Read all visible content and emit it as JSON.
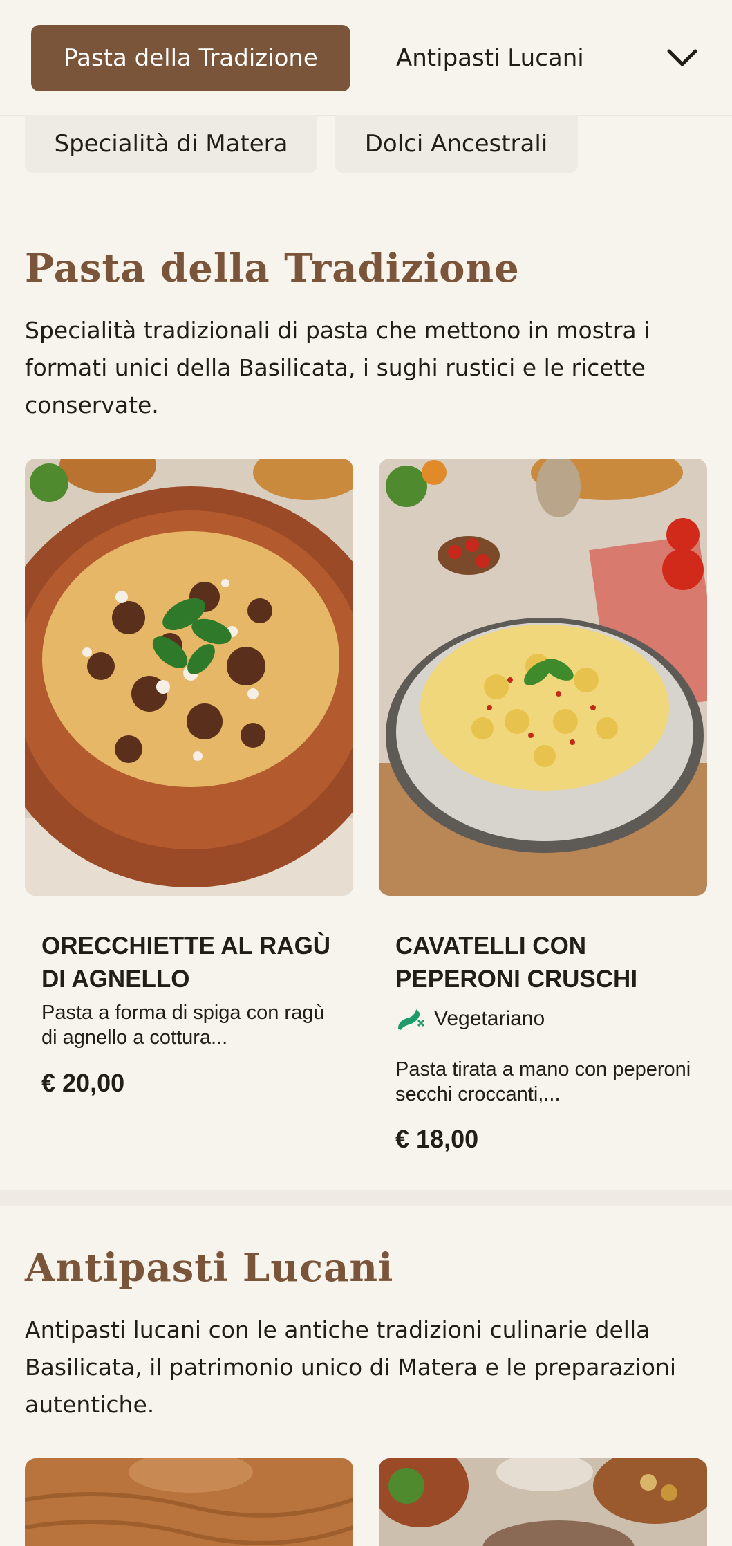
{
  "nav": {
    "tabs": [
      {
        "label": "Pasta della Tradizione",
        "active": true
      },
      {
        "label": "Antipasti Lucani",
        "active": false
      },
      {
        "label": "Specialità di Matera",
        "active": false
      },
      {
        "label": "Dolci Ancestrali",
        "active": false
      }
    ],
    "expand_icon": "chevron-down-icon"
  },
  "sections": [
    {
      "title": "Pasta della Tradizione",
      "description": "Specialità tradizionali di pasta che mettono in mostra i formati unici della Basilicata, i sughi rustici e le ricette conservate.",
      "dishes": [
        {
          "name": "ORECCHIETTE AL RAGÙ DI AGNELLO",
          "description": "Pasta a forma di spiga con ragù di agnello a cottura...",
          "price": "€ 20,00"
        },
        {
          "name": "CAVATELLI CON PEPERONI CRUSCHI",
          "tag": "Vegetariano",
          "tag_icon": "vegetarian-icon",
          "description": "Pasta tirata a mano con peperoni secchi croccanti,...",
          "price": "€ 18,00"
        }
      ]
    },
    {
      "title": "Antipasti Lucani",
      "description": "Antipasti lucani con le antiche tradizioni culinarie della Basilicata, il patrimonio unico di Matera e le preparazioni autentiche."
    }
  ],
  "colors": {
    "accent": "#7b553a",
    "background": "#f7f3ed",
    "vegetarian": "#1f9a6a"
  }
}
